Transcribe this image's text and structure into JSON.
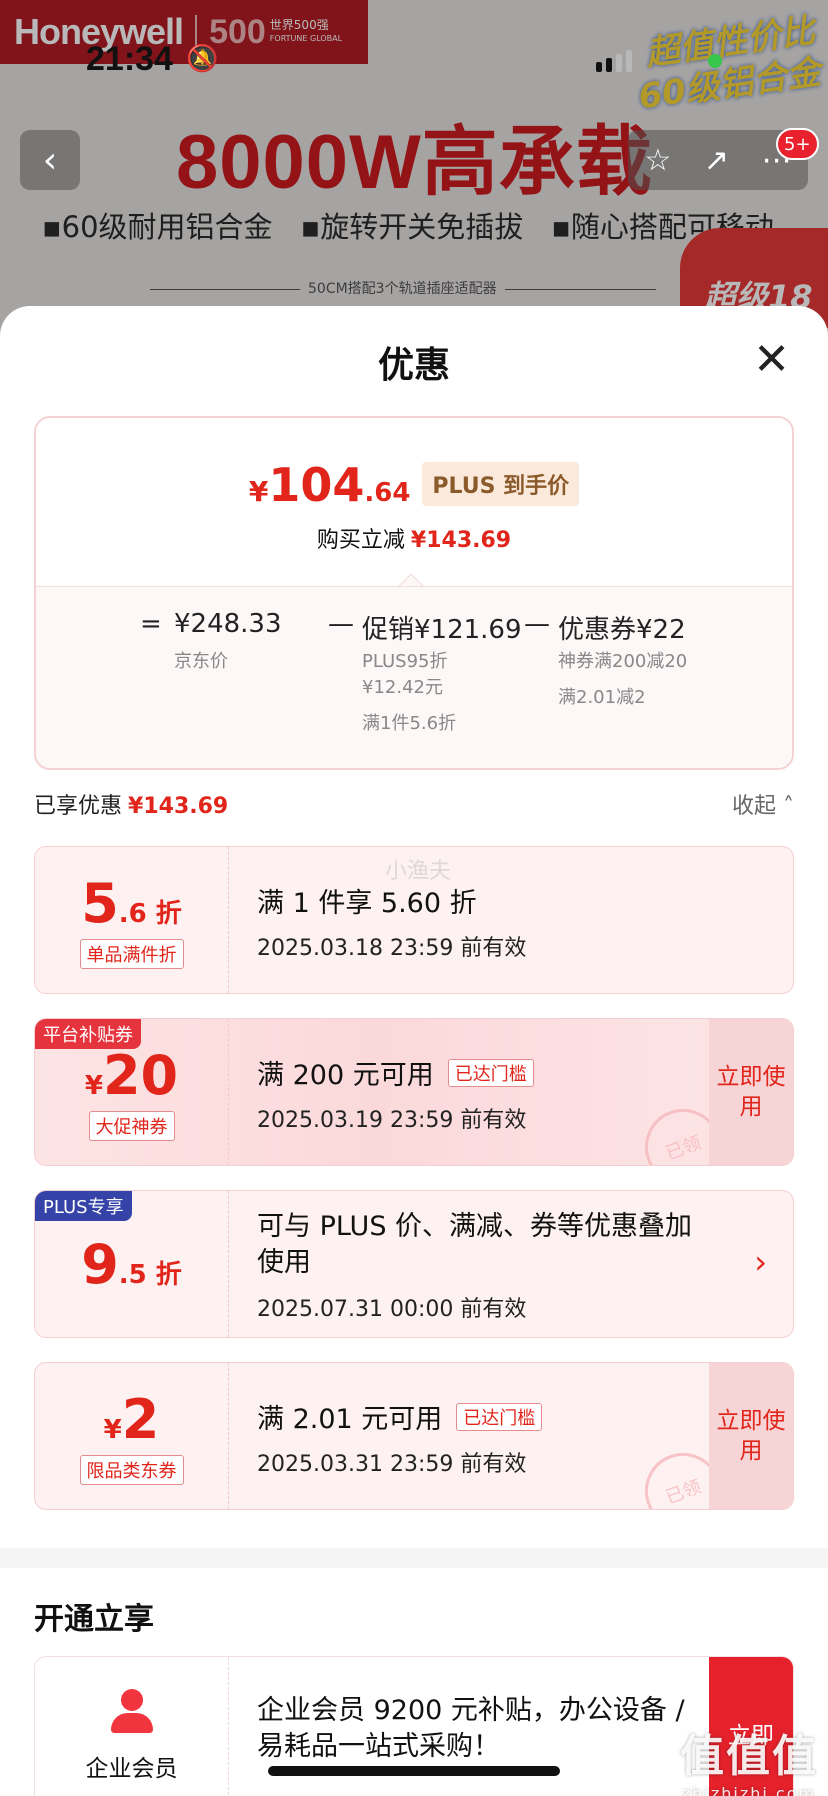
{
  "banner": {
    "brand": "Honeywell",
    "brand_500": "500",
    "brand_500_cn": "世界500强",
    "brand_500_en": "FORTUNE GLOBAL",
    "corner_promo_line1": "超值性价比",
    "corner_promo_line2": "60级铝合金",
    "headline": "8000W高承载",
    "features": [
      "▪60级耐用铝合金",
      "▪旋转开关免插拔",
      "▪随心搭配可移动"
    ],
    "sub_caption": "50CM搭配3个轨道插座适配器",
    "super_badge": "超级18"
  },
  "status": {
    "time": "21:34",
    "bell_icon": "🔕"
  },
  "nav": {
    "back": "‹",
    "star": "☆",
    "share": "↗",
    "more": "⋯",
    "badge": "5+"
  },
  "sheet": {
    "title": "优惠",
    "close": "✕",
    "summary": {
      "price_symbol": "¥",
      "price_int": "104",
      "price_dec": ".64",
      "plus_tag": "PLUS 到手价",
      "saving_label": "购买立减",
      "saving_value": "¥143.69",
      "eq": "=",
      "jd_price": "¥248.33",
      "jd_label": "京东价",
      "minus1": "—",
      "promo": "促销¥121.69",
      "promo_sub1": "PLUS95折",
      "promo_sub2": "¥12.42元",
      "promo_sub3": "满1件5.6折",
      "minus2": "—",
      "coupon": "优惠券¥22",
      "coupon_sub1": "神券满200减20",
      "coupon_sub2": "满2.01减2"
    },
    "enjoyed_label": "已享优惠",
    "enjoyed_value": "¥143.69",
    "collapse_label": "收起 ˄",
    "watermark": "小渔夫",
    "cards": [
      {
        "big": "5",
        "small": ".6 折",
        "sub": "单品满件折",
        "title": "满 1 件享 5.60 折",
        "validity": "2025.03.18 23:59 前有效"
      },
      {
        "corner": "平台补贴券",
        "sym": "¥",
        "big": "20",
        "sub": "大促神券",
        "title": "满 200 元可用",
        "thresh": "已达门槛",
        "validity": "2025.03.19 23:59 前有效",
        "action": "立即使用",
        "stamp": "已领"
      },
      {
        "corner": "PLUS专享",
        "big": "9",
        "small": ".5 折",
        "title": "可与 PLUS 价、满减、券等优惠叠加使用",
        "validity": "2025.07.31 00:00 前有效",
        "chevron": "›"
      },
      {
        "sym": "¥",
        "big": "2",
        "sub": "限品类东券",
        "title": "满 2.01 元可用",
        "thresh": "已达门槛",
        "validity": "2025.03.31 23:59 前有效",
        "action": "立即使用",
        "stamp": "已领"
      }
    ],
    "section_title": "开通立享",
    "member": {
      "name": "企业会员",
      "text": "企业会员 9200 元补贴，办公设备 / 易耗品一站式采购！",
      "action": "立即"
    }
  },
  "site_mark": {
    "big": "值值值",
    "small": "zhizhizhi.com"
  },
  "colors": {
    "accent": "#e1251b",
    "card_bg": "#fdf1f1",
    "plus_blue": "#3543a8"
  }
}
